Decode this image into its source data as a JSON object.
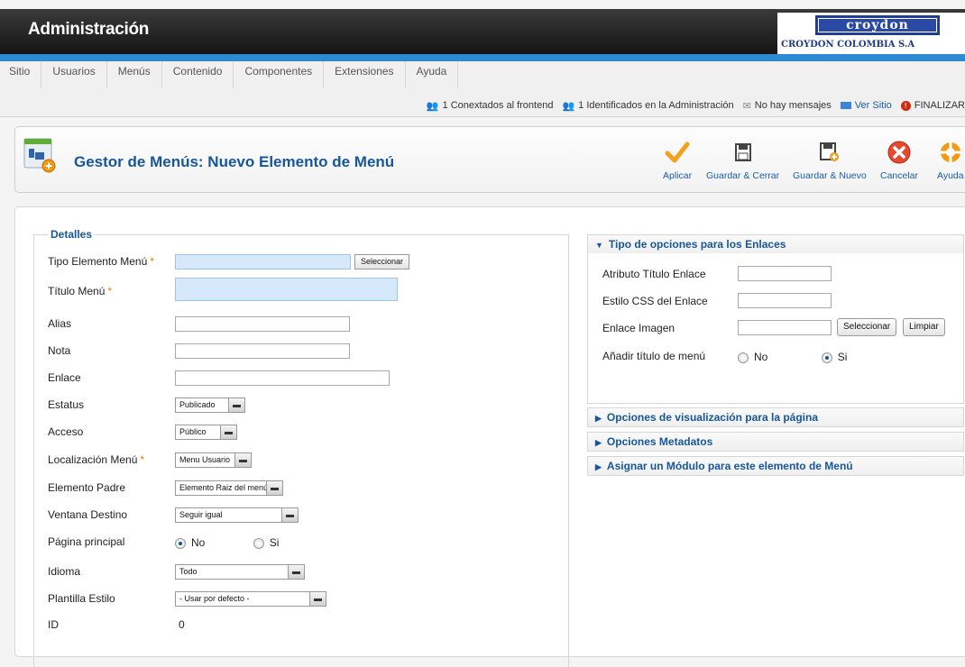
{
  "header": {
    "title": "Administración",
    "logo_word": "croydon",
    "logo_sub": "CROYDON COLOMBIA S.A"
  },
  "menu": {
    "items": [
      "Sitio",
      "Usuarios",
      "Menús",
      "Contenido",
      "Componentes",
      "Extensiones",
      "Ayuda"
    ]
  },
  "status": {
    "frontend": "1 Conextados al frontend",
    "admin": "1 Identificados en la Administración",
    "messages": "No hay mensajes",
    "view_site": "Ver Sitio",
    "logout": "FINALIZAR"
  },
  "toolbar": {
    "title": "Gestor de Menús: Nuevo Elemento de Menú",
    "apply": "Aplicar",
    "save_close": "Guardar & Cerrar",
    "save_new": "Guardar & Nuevo",
    "cancel": "Cancelar",
    "help": "Ayuda"
  },
  "form": {
    "legend": "Detalles",
    "tipo_label": "Tipo Elemento Menú",
    "tipo_button": "Seleccionar",
    "titulo_label": "Título Menú",
    "alias_label": "Alias",
    "nota_label": "Nota",
    "enlace_label": "Enlace",
    "estatus_label": "Estatus",
    "estatus_value": "Publicado",
    "acceso_label": "Acceso",
    "acceso_value": "Público",
    "localizacion_label": "Localización Menú",
    "localizacion_value": "Menu Usuario",
    "padre_label": "Elemento Padre",
    "padre_value": "Elemento Raiz del menú",
    "ventana_label": "Ventana Destino",
    "ventana_value": "Seguir igual",
    "principal_label": "Página principal",
    "principal_no": "No",
    "principal_si": "Si",
    "idioma_label": "Idioma",
    "idioma_value": "Todo",
    "plantilla_label": "Plantilla Estilo",
    "plantilla_value": "- Usar por defecto -",
    "id_label": "ID",
    "id_value": "0",
    "required_mark": "*"
  },
  "panel": {
    "open_title": "Tipo de opciones para los Enlaces",
    "atributo_label": "Atributo Título Enlace",
    "css_label": "Estilo CSS del Enlace",
    "imagen_label": "Enlace Imagen",
    "imagen_select": "Seleccionar",
    "imagen_clear": "Limpiar",
    "anadir_label": "Añadir título de menú",
    "anadir_no": "No",
    "anadir_si": "Si",
    "closed": [
      "Opciones de visualización para la página",
      "Opciones Metadatos",
      "Asignar un Módulo para este elemento de Menú"
    ]
  }
}
